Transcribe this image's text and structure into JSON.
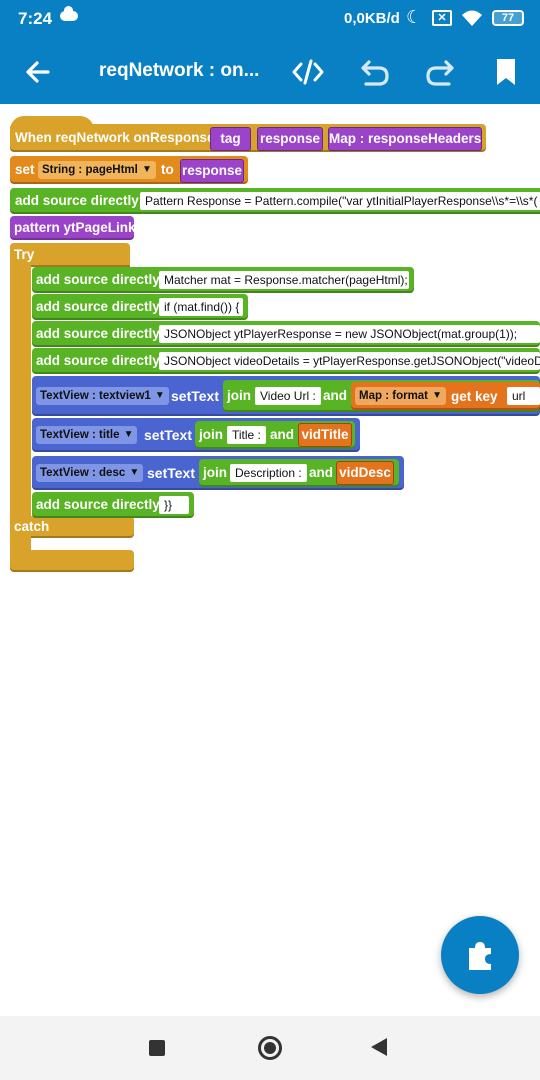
{
  "status_bar": {
    "time": "7:24",
    "network_speed": "0,0KB/d",
    "battery": "77"
  },
  "toolbar": {
    "title": "reqNetwork : on..."
  },
  "colors": {
    "primary": "#0a80c4",
    "event_block": "#d9a22a",
    "set_block": "#e28a1c",
    "param_block": "#9b44c9",
    "code_block": "#58b424",
    "view_block": "#4a65d0"
  },
  "icons": [
    "back-arrow-icon",
    "code-icon",
    "undo-icon",
    "redo-icon",
    "bookmark-icon",
    "puzzle-icon"
  ],
  "blocks": {
    "event": {
      "label": "When reqNetwork onResponse",
      "params": [
        "tag",
        "response",
        "Map : responseHeaders"
      ]
    },
    "set": {
      "label": "set",
      "var_dropdown": {
        "type": "String :",
        "name": "pageHtml"
      },
      "to_label": "to",
      "value": "response"
    },
    "add_source_1": {
      "label": "add source directly",
      "code": "Pattern Response = Pattern.compile(\"var ytInitialPlayerResponse\\\\s*=\\\\s*("
    },
    "pattern": {
      "label": "pattern ytPageLink"
    },
    "try": {
      "label": "Try",
      "catch_label": "catch"
    },
    "inner": [
      {
        "label": "add source directly",
        "code": "Matcher mat = Response.matcher(pageHtml);"
      },
      {
        "label": "add source directly",
        "code": "if (mat.find()) {"
      },
      {
        "label": "add source directly",
        "code": "JSONObject ytPlayerResponse = new JSONObject(mat.group(1));"
      },
      {
        "label": "add source directly",
        "code": " JSONObject videoDetails = ytPlayerResponse.getJSONObject(\"videoD"
      }
    ],
    "settext": [
      {
        "view_type": "TextView :",
        "view_name": "textview1",
        "action": "setText",
        "join": "join",
        "text": "Video Url :",
        "and": "and",
        "map_type": "Map :",
        "map_name": "format",
        "get_key": "get key",
        "key": "url"
      },
      {
        "view_type": "TextView :",
        "view_name": "title",
        "action": "setText",
        "join": "join",
        "text": "Title :",
        "and": "and",
        "var": "vidTitle"
      },
      {
        "view_type": "TextView :",
        "view_name": "desc",
        "action": "setText",
        "join": "join",
        "text": "Description :",
        "and": "and",
        "var": "vidDesc"
      }
    ],
    "close": {
      "label": "add source directly",
      "code": "}}"
    }
  }
}
